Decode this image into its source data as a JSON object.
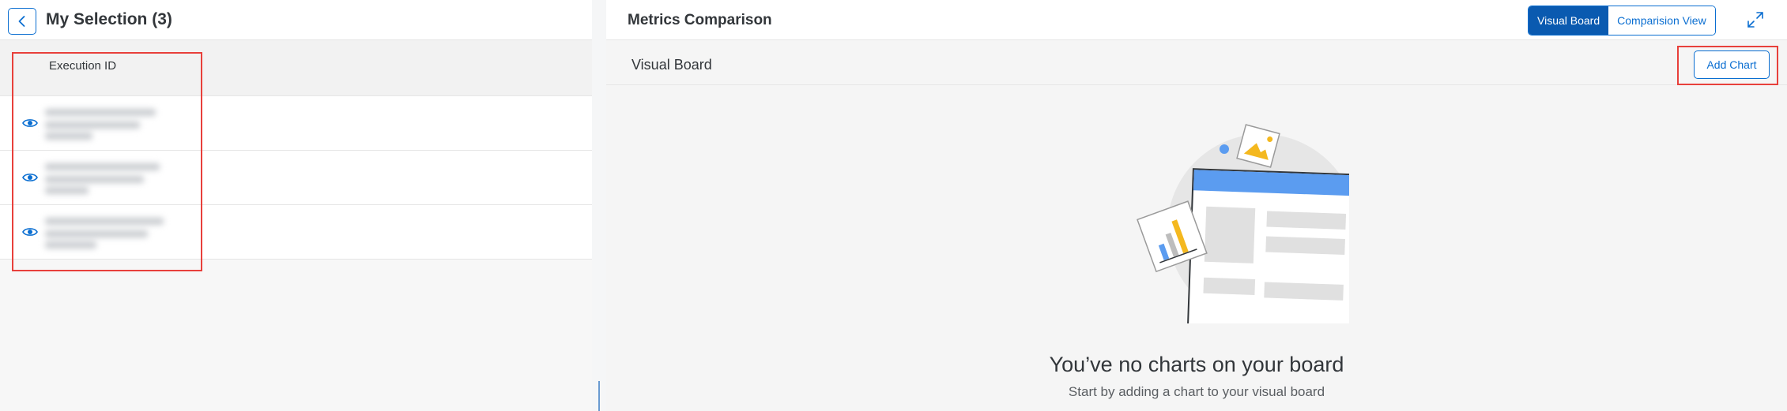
{
  "left_panel": {
    "title": "My Selection (3)",
    "column_header": "Execution ID",
    "rows": [
      {
        "icon": "eye-icon"
      },
      {
        "icon": "eye-icon"
      },
      {
        "icon": "eye-icon"
      }
    ]
  },
  "right_panel": {
    "title": "Metrics Comparison",
    "toggle": {
      "options": [
        "Visual Board",
        "Comparision View"
      ],
      "selected": "Visual Board"
    },
    "sub_title": "Visual Board",
    "add_chart_label": "Add Chart",
    "empty_state": {
      "title": "You’ve no charts on your board",
      "subtitle": "Start by adding a chart to your visual board"
    }
  },
  "colors": {
    "accent": "#0a6ed1",
    "highlight": "#e8403b",
    "illustration_blue": "#5b9cf0",
    "illustration_yellow": "#f4b81f"
  }
}
